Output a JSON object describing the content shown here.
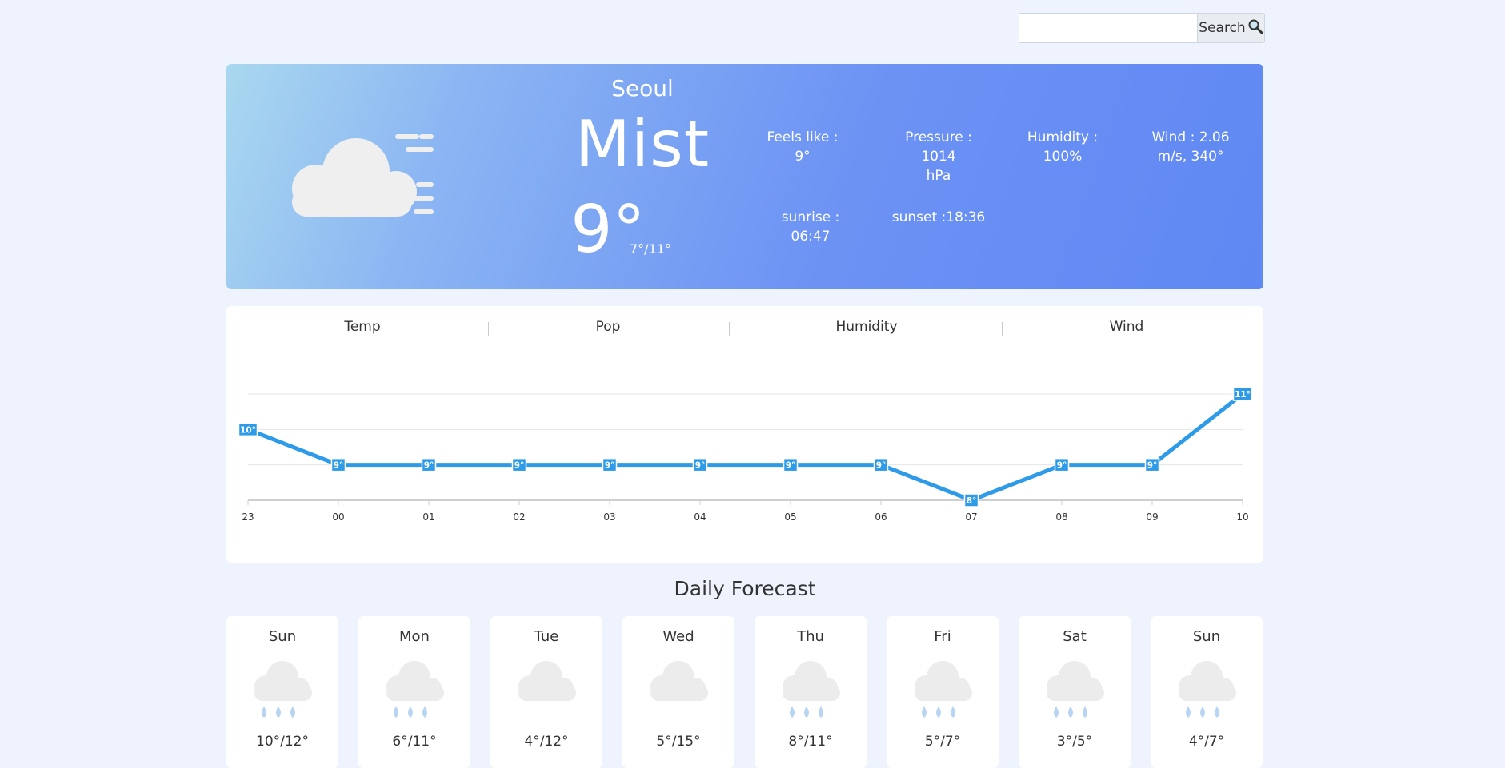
{
  "search": {
    "placeholder": "",
    "button_label": "Search"
  },
  "current": {
    "city": "Seoul",
    "description": "Mist",
    "temp": "9°",
    "min_max": "7°/11°",
    "icon": "mist-cloud-icon",
    "feels_like": "Feels like : 9°",
    "pressure_line1": "Pressure : 1014",
    "pressure_line2": "hPa",
    "humidity_line1": "Humidity :",
    "humidity_line2": "100%",
    "wind_line1": "Wind : 2.06",
    "wind_line2": "m/s, 340°",
    "sunrise": "sunrise : 06:47",
    "sunset": "sunset :18:36"
  },
  "chart_tabs": [
    "Temp",
    "Pop",
    "Humidity",
    "Wind"
  ],
  "chart_data": {
    "type": "line",
    "x": [
      "23",
      "00",
      "01",
      "02",
      "03",
      "04",
      "05",
      "06",
      "07",
      "08",
      "09",
      "10"
    ],
    "y": [
      10,
      9,
      9,
      9,
      9,
      9,
      9,
      9,
      8,
      9,
      9,
      11
    ],
    "point_labels": [
      "10°",
      "9°",
      "9°",
      "9°",
      "9°",
      "9°",
      "9°",
      "9°",
      "8°",
      "9°",
      "9°",
      "11°"
    ],
    "ylim": [
      8,
      11
    ],
    "grid": true,
    "color": "#2e9be8"
  },
  "daily": {
    "title": "Daily Forecast",
    "days": [
      {
        "day": "Sun",
        "range": "10°/12°",
        "icon": "rain-cloud-icon"
      },
      {
        "day": "Mon",
        "range": "6°/11°",
        "icon": "rain-cloud-icon"
      },
      {
        "day": "Tue",
        "range": "4°/12°",
        "icon": "cloud-icon"
      },
      {
        "day": "Wed",
        "range": "5°/15°",
        "icon": "cloud-icon"
      },
      {
        "day": "Thu",
        "range": "8°/11°",
        "icon": "rain-cloud-icon"
      },
      {
        "day": "Fri",
        "range": "5°/7°",
        "icon": "rain-cloud-icon"
      },
      {
        "day": "Sat",
        "range": "3°/5°",
        "icon": "rain-cloud-icon"
      },
      {
        "day": "Sun",
        "range": "4°/7°",
        "icon": "rain-cloud-icon"
      }
    ]
  }
}
